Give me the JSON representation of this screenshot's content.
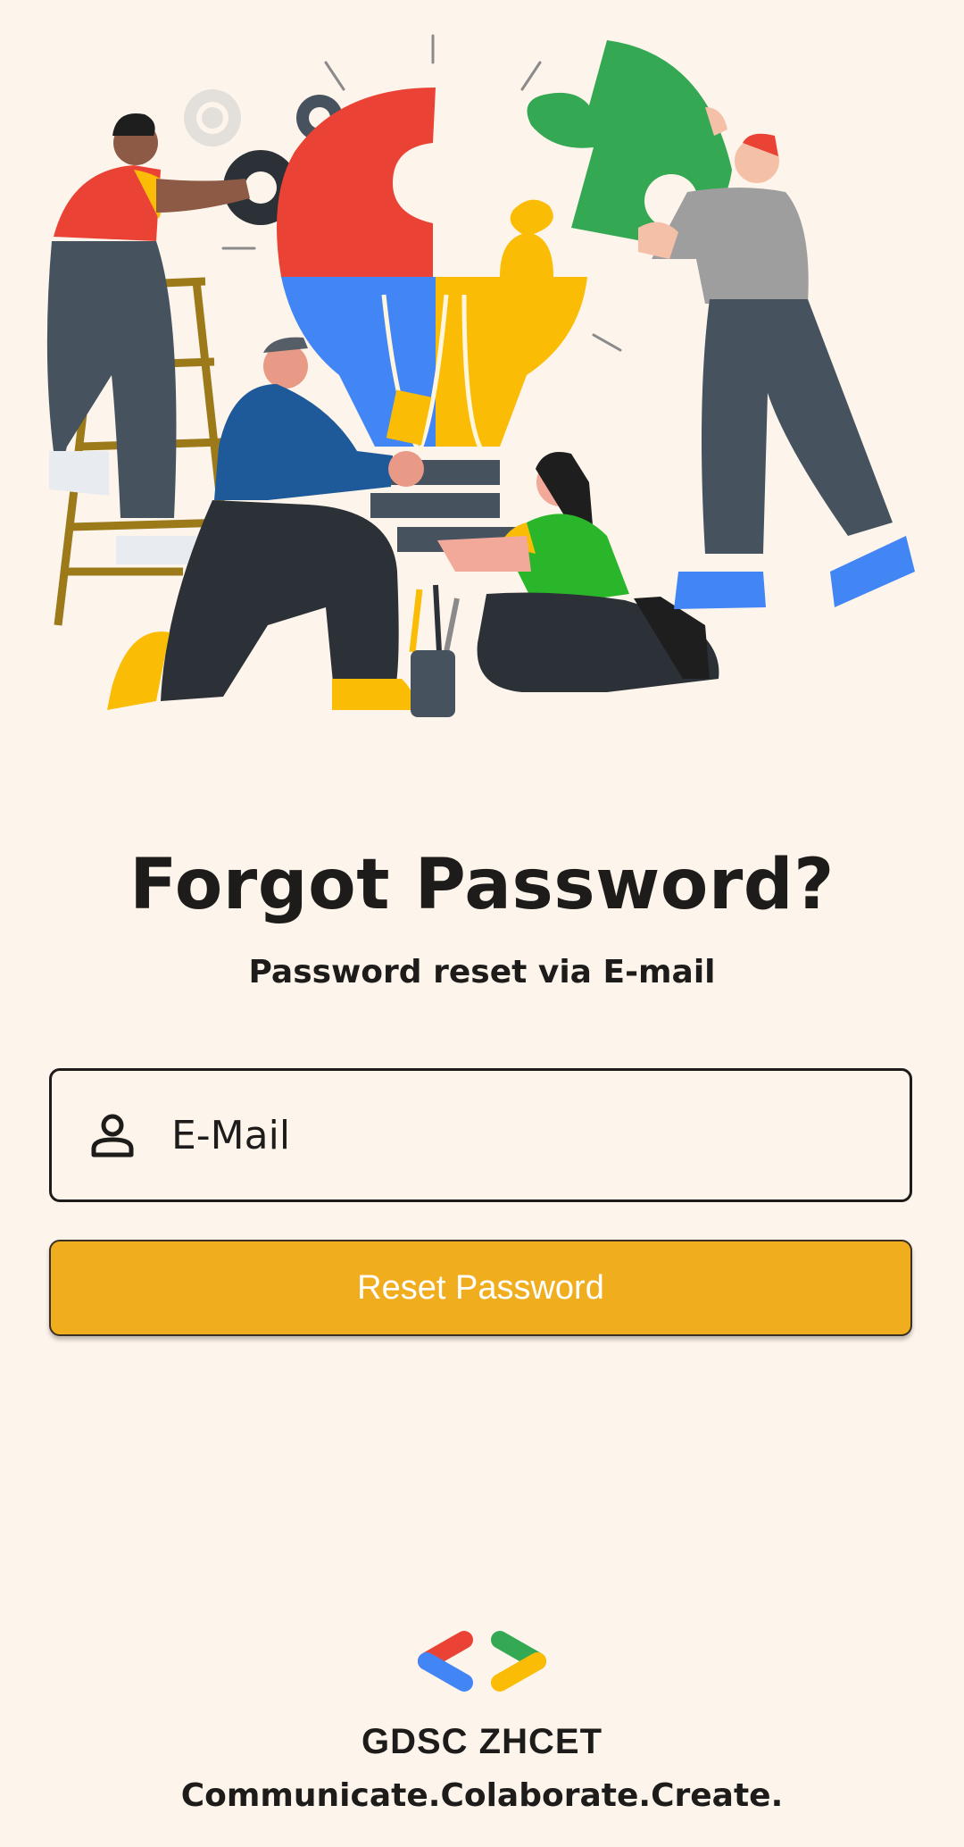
{
  "header": {
    "title": "Forgot Password?",
    "subtitle": "Password reset via E-mail"
  },
  "form": {
    "email_placeholder": "E-Mail",
    "email_icon": "person-icon",
    "submit_label": "Reset Password"
  },
  "footer": {
    "logo_icon": "gdsc-logo-icon",
    "org_name": "GDSC ZHCET",
    "tagline": "Communicate.Colaborate.Create."
  },
  "colors": {
    "background": "#fdf5ec",
    "accent": "#f0ae1e",
    "text": "#1e1c1a",
    "google_red": "#ea4335",
    "google_blue": "#4285f4",
    "google_green": "#34a853",
    "google_yellow": "#fbbc05"
  }
}
